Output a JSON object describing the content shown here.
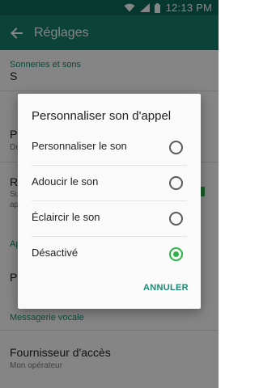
{
  "status_bar": {
    "time": "12:13 PM",
    "icons": [
      "wifi-icon",
      "signal-icon",
      "battery-icon"
    ]
  },
  "app_bar": {
    "title": "Réglages",
    "back_icon": "back-arrow-icon"
  },
  "background": {
    "section_sounds": "Sonneries et sons",
    "item_peek_s": "S",
    "item_peek_p": "P",
    "item_peek_p_sub": "De",
    "item_peek_r": "R",
    "item_peek_r_sub1": "Su",
    "item_peek_r_sub2": "ap",
    "section_peek_a": "Ap",
    "item_peek_p2": "P",
    "section_voicemail": "Messagerie vocale",
    "provider_title": "Fournisseur d'accès",
    "provider_sub": "Mon opérateur"
  },
  "dialog": {
    "title": "Personnaliser son d'appel",
    "options": [
      {
        "label": "Personnaliser le son",
        "selected": false
      },
      {
        "label": "Adoucir le son",
        "selected": false
      },
      {
        "label": "Éclaircir le son",
        "selected": false
      },
      {
        "label": "Désactivé",
        "selected": true
      }
    ],
    "cancel_label": "ANNULER"
  },
  "colors": {
    "status_bar": "#0f6b5c",
    "app_bar": "#16806d",
    "accent": "#1a8b72",
    "radio_selected": "#2db34a"
  }
}
